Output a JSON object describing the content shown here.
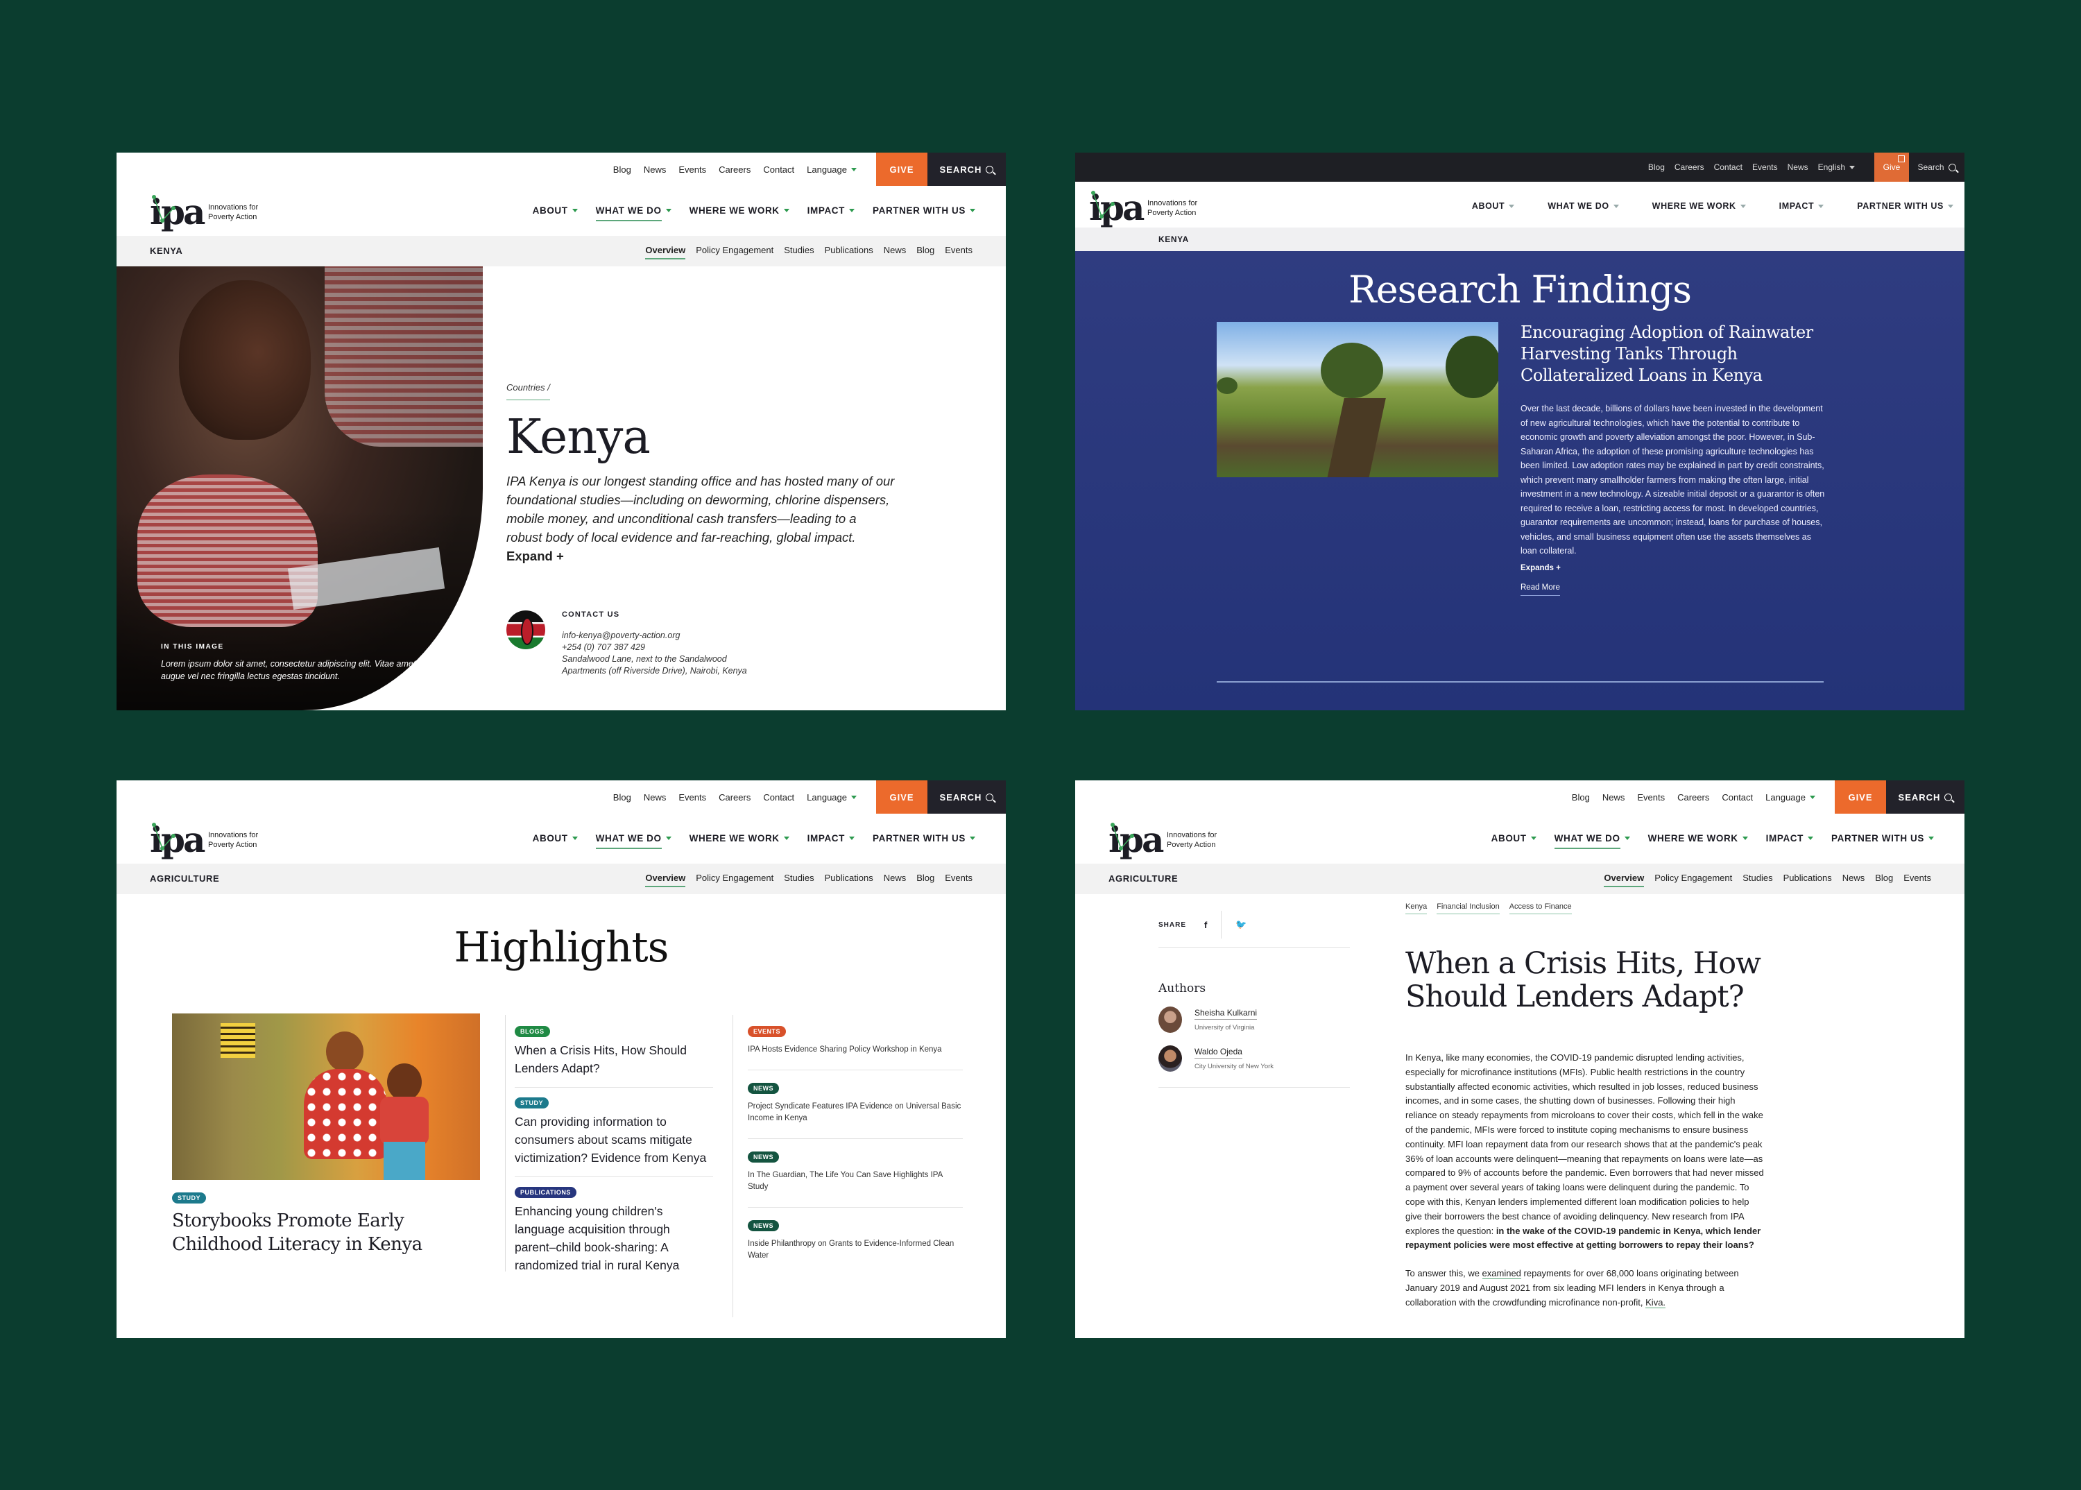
{
  "colors": {
    "background": "#0b3d2f",
    "give": "#ec6a2c",
    "search": "#22222a",
    "accent_green": "#5da77b",
    "research_blue": "#2f3c80"
  },
  "brand": {
    "logo_letters": "ipa",
    "logo_line1": "Innovations for",
    "logo_line2": "Poverty Action"
  },
  "utility_nav": {
    "links": [
      "Blog",
      "News",
      "Events",
      "Careers",
      "Contact"
    ],
    "language": "Language",
    "give": "GIVE",
    "search": "SEARCH"
  },
  "utility_nav_alt": {
    "links": [
      "Blog",
      "Careers",
      "Contact",
      "Events",
      "News"
    ],
    "language": "English",
    "give": "Give",
    "search": "Search"
  },
  "main_nav": [
    "ABOUT",
    "WHAT WE DO",
    "WHERE WE WORK",
    "IMPACT",
    "PARTNER WITH US"
  ],
  "sub_nav": [
    "Overview",
    "Policy Engagement",
    "Studies",
    "Publications",
    "News",
    "Blog",
    "Events"
  ],
  "panel_kenya": {
    "section": "KENYA",
    "breadcrumb": "Countries /",
    "title": "Kenya",
    "description": "IPA Kenya is our longest standing office and has hosted many of our foundational studies—including on deworming, chlorine dispensers, mobile money, and unconditional cash transfers—leading to a robust body of local evidence and far-reaching, global impact.",
    "expand": "Expand +",
    "image_caption_label": "IN THIS IMAGE",
    "image_caption": "Lorem ipsum dolor sit amet, consectetur adipiscing elit. Vitae amet augue vel nec fringilla lectus egestas tincidunt.",
    "contact_label": "CONTACT US",
    "email": "info-kenya@poverty-action.org",
    "phone": "+254 (0) 707 387 429",
    "address_line1": "Sandalwood Lane, next to the Sandalwood",
    "address_line2": "Apartments (off Riverside Drive), Nairobi, Kenya"
  },
  "panel_research": {
    "section": "KENYA",
    "title": "Research Findings",
    "study_title": "Encouraging Adoption of Rainwater Harvesting Tanks Through Collateralized Loans in Kenya",
    "body": "Over the last decade, billions of dollars have been invested in the development of new agricultural technologies, which have the potential to contribute to economic growth and poverty alleviation amongst the poor. However, in Sub-Saharan Africa, the adoption of these promising agriculture technologies has been limited. Low adoption rates may be explained in part by credit constraints, which prevent many smallholder farmers from making the often large, initial investment in a new technology. A sizeable initial deposit or a guarantor is often required to receive a loan, restricting access for most. In developed countries, guarantor requirements are uncommon; instead, loans for purchase of houses, vehicles, and small business equipment often use the assets themselves as loan collateral.",
    "expand": "Expands +",
    "read_more": "Read More"
  },
  "panel_highlights": {
    "section": "AGRICULTURE",
    "title": "Highlights",
    "featured": {
      "tag": "STUDY",
      "title": "Storybooks Promote Early Childhood Literacy in Kenya"
    },
    "middle": [
      {
        "tag": "BLOGS",
        "type": "blogs",
        "title": "When a Crisis Hits, How Should Lenders Adapt?"
      },
      {
        "tag": "STUDY",
        "type": "study",
        "title": "Can providing information to consumers about scams mitigate victimization? Evidence from Kenya"
      },
      {
        "tag": "PUBLICATIONS",
        "type": "pubs",
        "title": "Enhancing young children's language acquisition through parent–child book-sharing: A randomized trial in rural Kenya"
      }
    ],
    "right": [
      {
        "tag": "EVENTS",
        "type": "events",
        "title": "IPA Hosts Evidence Sharing Policy Workshop in Kenya"
      },
      {
        "tag": "NEWS",
        "type": "news",
        "title": "Project Syndicate Features IPA Evidence on Universal Basic Income in Kenya"
      },
      {
        "tag": "NEWS",
        "type": "news",
        "title": "In The Guardian, The Life You Can Save Highlights IPA Study"
      },
      {
        "tag": "NEWS",
        "type": "news",
        "title": "Inside Philanthropy on Grants to Evidence-Informed Clean Water"
      }
    ]
  },
  "panel_article": {
    "section": "AGRICULTURE",
    "share_label": "SHARE",
    "share_facebook": "f",
    "share_twitter": "🐦",
    "authors_heading": "Authors",
    "authors": [
      {
        "name": "Sheisha Kulkarni",
        "affiliation": "University of Virginia"
      },
      {
        "name": "Waldo Ojeda",
        "affiliation": "City University of New York"
      }
    ],
    "tags": [
      "Kenya",
      "Financial Inclusion",
      "Access to Finance"
    ],
    "title": "When a Crisis Hits, How Should Lenders Adapt?",
    "para1": "In Kenya, like many economies, the COVID-19 pandemic disrupted lending activities, especially for microfinance institutions (MFIs). Public health restrictions in the country substantially affected economic activities, which resulted in job losses, reduced business incomes, and in some cases, the shutting down of businesses. Following their high reliance on steady repayments from microloans to cover their costs, which fell in the wake of the pandemic, MFIs were forced to institute coping mechanisms to ensure business continuity. MFI loan repayment data from our research shows that at the pandemic's peak 36% of loan accounts were delinquent—meaning that repayments on loans were late—as compared to 9% of accounts before the pandemic. Even borrowers that had never missed a payment over several years of taking loans were delinquent during the pandemic. To cope with this, Kenyan lenders implemented different loan modification policies to help give their borrowers the best chance of avoiding delinquency. New research from IPA explores the question: ",
    "para1_bold": "in the wake of the COVID-19 pandemic in Kenya, which lender repayment policies were most effective at getting borrowers to repay their loans?",
    "para2_a": "To answer this, we ",
    "para2_link": "examined",
    "para2_b": " repayments for over 68,000 loans originating between January 2019 and August 2021 from six leading MFI lenders in Kenya through a collaboration with the crowdfunding microfinance non-profit, ",
    "para2_kiva": "Kiva."
  }
}
